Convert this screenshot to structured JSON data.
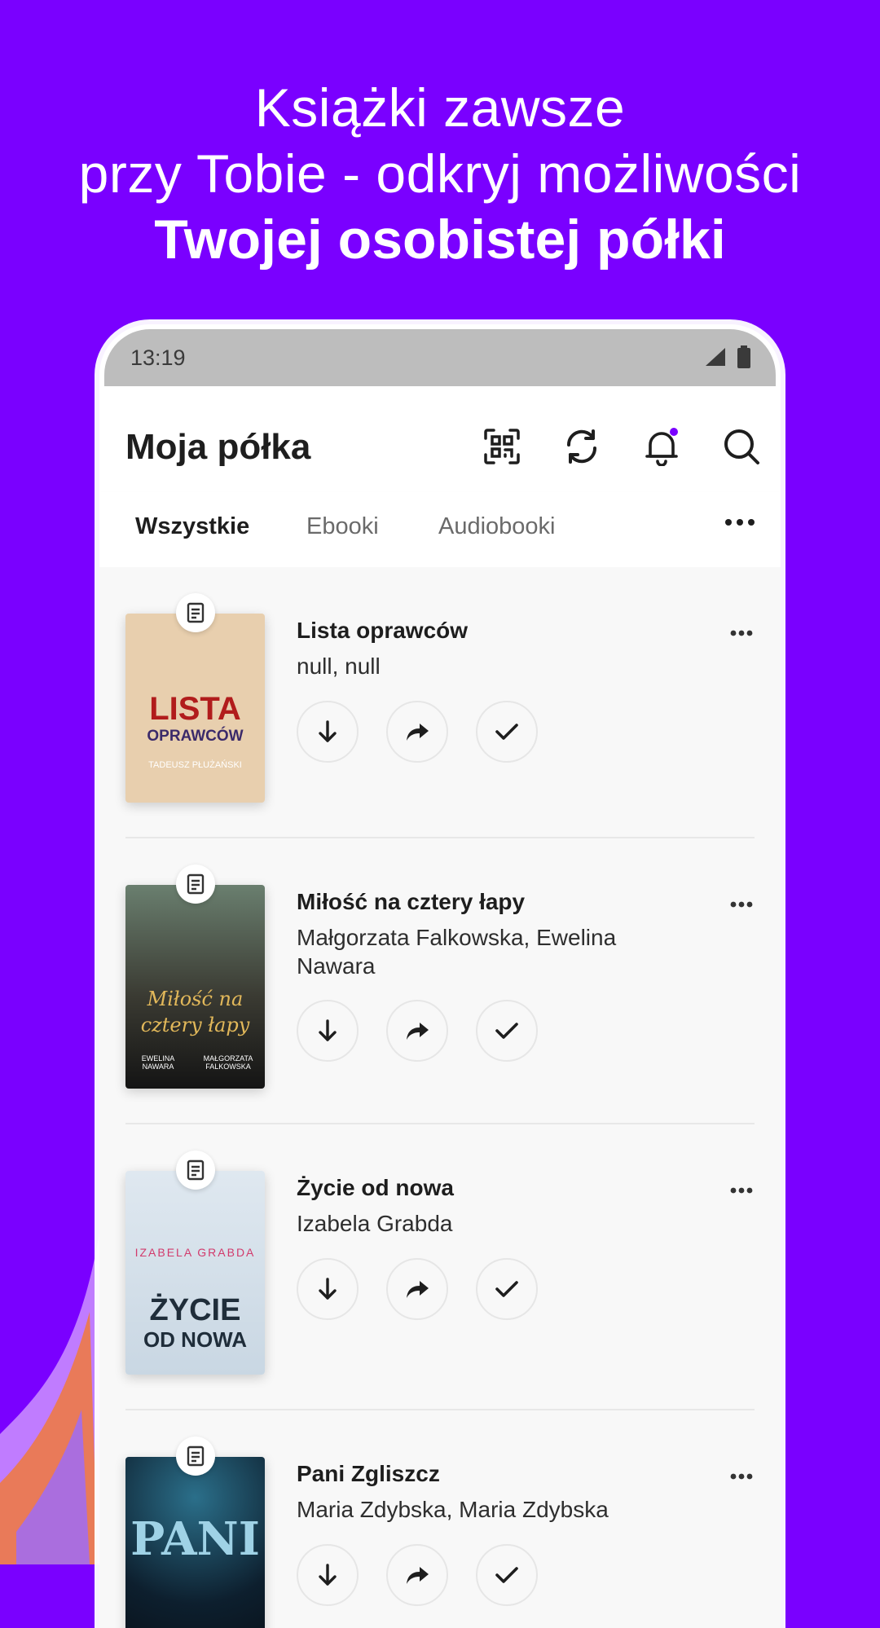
{
  "headline": {
    "line1": "Książki zawsze",
    "line2": "przy Tobie - odkryj możliwości",
    "line3": "Twojej osobistej półki"
  },
  "status_bar": {
    "time": "13:19"
  },
  "app_bar": {
    "title": "Moja półka",
    "icons": [
      "qr-code-icon",
      "sync-icon",
      "bell-icon",
      "search-icon"
    ],
    "notification_dot_color": "#7a00ff"
  },
  "tabs": [
    {
      "label": "Wszystkie",
      "active": true
    },
    {
      "label": "Ebooki",
      "active": false
    },
    {
      "label": "Audiobooki",
      "active": false
    }
  ],
  "books": [
    {
      "title": "Lista oprawców",
      "author": "null, null",
      "cover": {
        "line1": "LISTA",
        "line2": "OPRAWCÓW",
        "author": "TADEUSZ PŁUŻAŃSKI"
      }
    },
    {
      "title": "Miłość na cztery łapy",
      "author": "Małgorzata Falkowska, Ewelina Nawara",
      "cover": {
        "line1": "Miłość na",
        "line2": "cztery łapy",
        "author_left": "EWELINA NAWARA",
        "author_right": "MAŁGORZATA FALKOWSKA"
      }
    },
    {
      "title": "Życie od nowa",
      "author": "Izabela Grabda",
      "cover": {
        "author": "IZABELA GRABDA",
        "line1": "ŻYCIE",
        "line2": "OD NOWA"
      }
    },
    {
      "title": "Pani Zgliszcz",
      "author": "Maria Zdybska, Maria Zdybska",
      "cover": {
        "line1": "PANI"
      }
    }
  ],
  "colors": {
    "background": "#7a00ff",
    "accent": "#7a00ff",
    "text": "#1e1e1e"
  }
}
